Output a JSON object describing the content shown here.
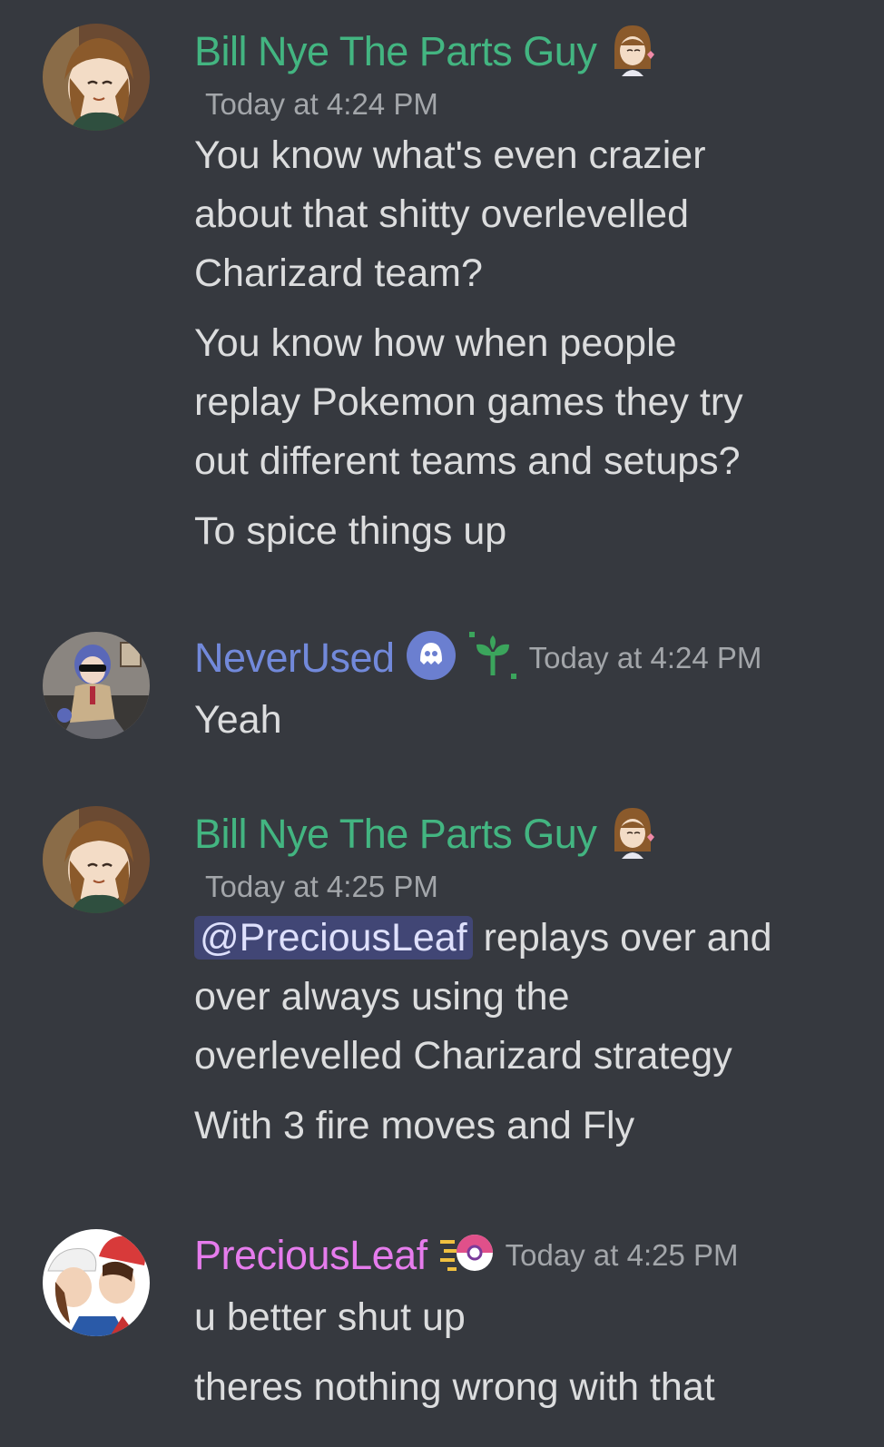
{
  "colors": {
    "background": "#36393f",
    "bill_name": "#43b581",
    "neverused_name": "#7289da",
    "preciousleaf_name": "#e67ced",
    "mention_bg": "#414675"
  },
  "messages": [
    {
      "author": "Bill Nye The Parts Guy",
      "timestamp": "Today at 4:24 PM",
      "paragraphs": [
        "You know what's even crazier\nabout that shitty overlevelled\nCharizard team?",
        "You know how when people\nreplay Pokemon games they try\nout different teams and setups?",
        "To spice things up"
      ]
    },
    {
      "author": "NeverUsed",
      "timestamp": "Today at 4:24 PM",
      "paragraphs": [
        "Yeah"
      ]
    },
    {
      "author": "Bill Nye The Parts Guy",
      "timestamp": "Today at 4:25 PM",
      "mention": "@PreciousLeaf",
      "first_line_rest": " replays over and",
      "paragraphs": [
        "over always using the\noverlevelled Charizard strategy",
        "With 3 fire moves and Fly"
      ]
    },
    {
      "author": "PreciousLeaf",
      "timestamp": "Today at 4:25 PM",
      "paragraphs": [
        "u better shut up",
        "theres nothing wrong with that"
      ]
    }
  ]
}
